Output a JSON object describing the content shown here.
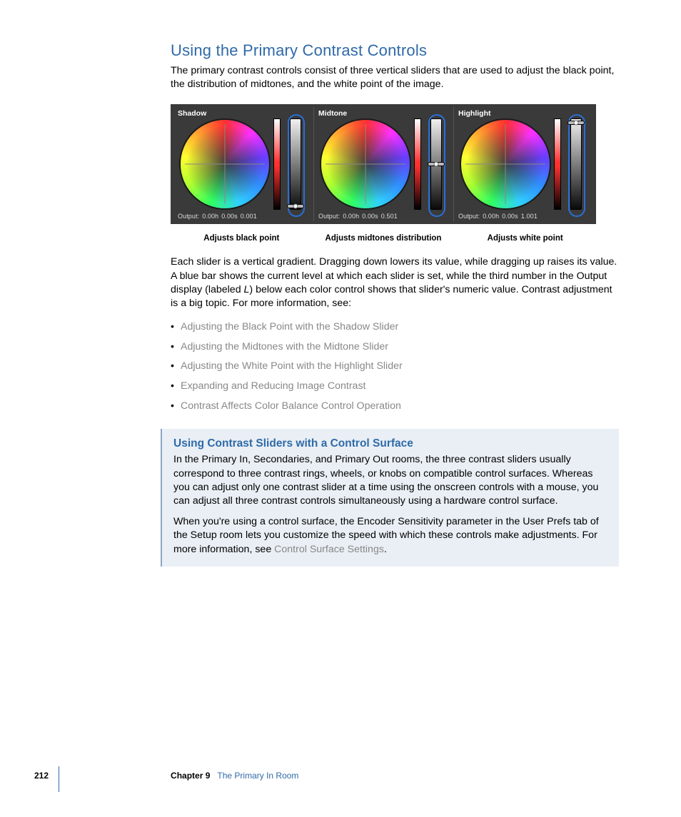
{
  "heading": "Using the Primary Contrast Controls",
  "intro": "The primary contrast controls consist of three vertical sliders that are used to adjust the black point, the distribution of midtones, and the white point of the image.",
  "panels": [
    {
      "label": "Shadow",
      "output_prefix": "Output:",
      "h": "0.00h",
      "s": "0.00s",
      "l": "0.001",
      "handle_pct": 98,
      "caption": "Adjusts black point"
    },
    {
      "label": "Midtone",
      "output_prefix": "Output:",
      "h": "0.00h",
      "s": "0.00s",
      "l": "0.501",
      "handle_pct": 50,
      "caption": "Adjusts midtones distribution"
    },
    {
      "label": "Highlight",
      "output_prefix": "Output:",
      "h": "0.00h",
      "s": "0.00s",
      "l": "1.001",
      "handle_pct": 2,
      "caption": "Adjusts white point"
    }
  ],
  "para2_part1": "Each slider is a vertical gradient. Dragging down lowers its value, while dragging up raises its value. A blue bar shows the current level at which each slider is set, while the third number in the Output display (labeled ",
  "para2_em": "L",
  "para2_part2": ") below each color control shows that slider's numeric value. Contrast adjustment is a big topic. For more information, see:",
  "links": [
    "Adjusting the Black Point with the Shadow Slider",
    "Adjusting the Midtones with the Midtone Slider",
    "Adjusting the White Point with the Highlight Slider",
    "Expanding and Reducing Image Contrast",
    "Contrast Affects Color Balance Control Operation"
  ],
  "sidebar": {
    "title": "Using Contrast Sliders with a Control Surface",
    "p1": "In the Primary In, Secondaries, and Primary Out rooms, the three contrast sliders usually correspond to three contrast rings, wheels, or knobs on compatible control surfaces. Whereas you can adjust only one contrast slider at a time using the onscreen controls with a mouse, you can adjust all three contrast controls simultaneously using a hardware control surface.",
    "p2a": "When you're using a control surface, the Encoder Sensitivity parameter in the User Prefs tab of the Setup room lets you customize the speed with which these controls make adjustments. For more information, see ",
    "p2link": "Control Surface Settings",
    "p2b": "."
  },
  "footer": {
    "page": "212",
    "chapter": "Chapter 9",
    "name": "The Primary In Room"
  }
}
